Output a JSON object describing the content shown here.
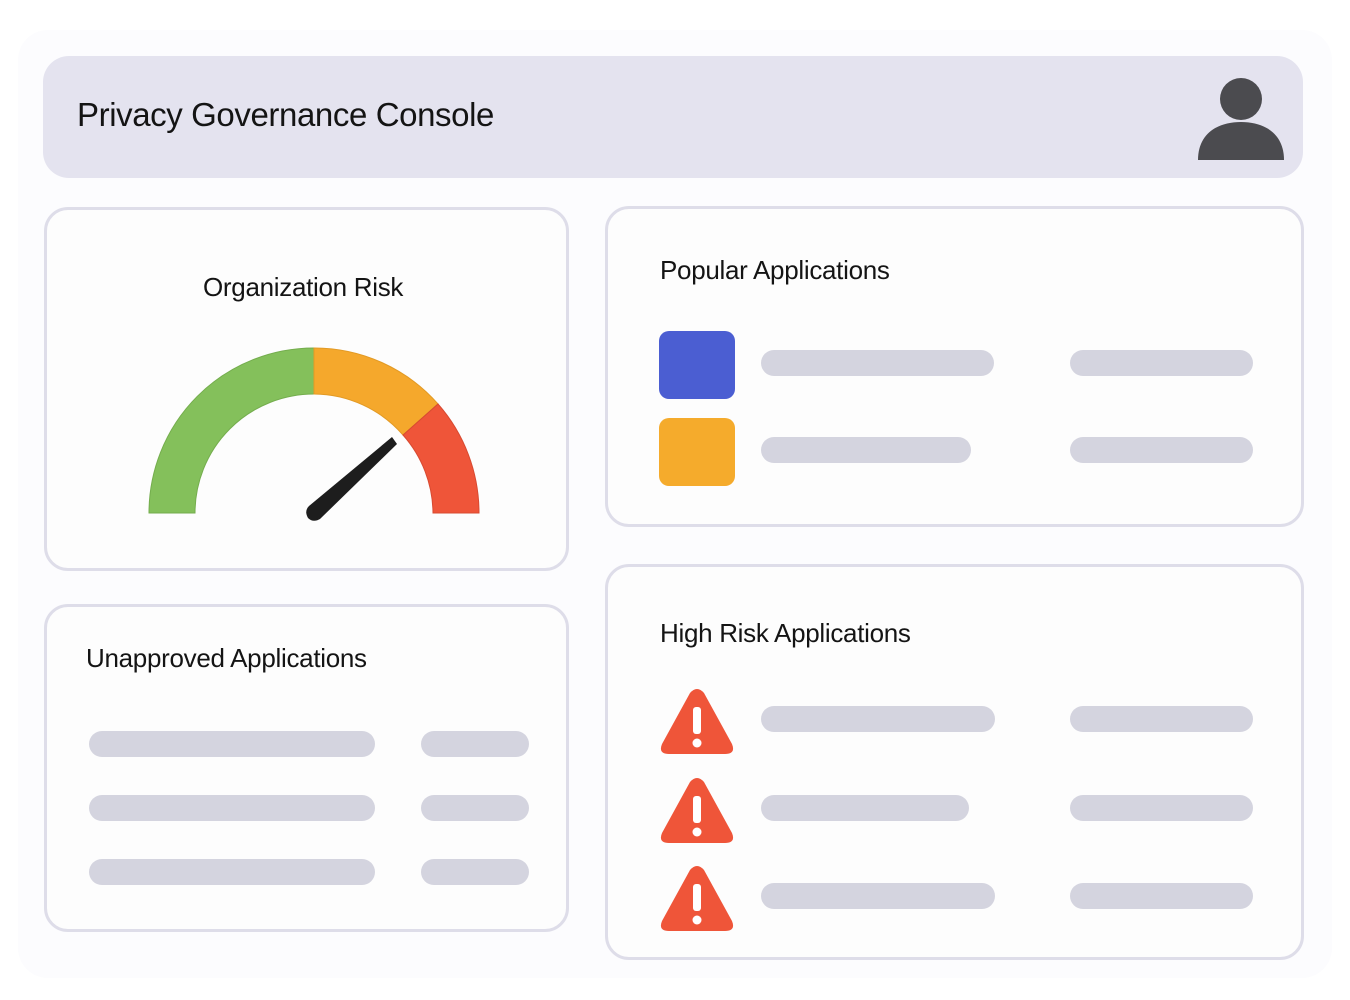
{
  "header": {
    "title": "Privacy Governance Console",
    "user_icon": "user-avatar-icon"
  },
  "org_risk": {
    "title": "Organization Risk",
    "gauge_colors": [
      "#84c05b",
      "#f5a82c",
      "#ef5539"
    ],
    "needle_color": "#1d1d1d"
  },
  "popular_apps": {
    "title": "Popular Applications",
    "items": [
      {
        "color": "#4b5ed2"
      },
      {
        "color": "#f5ab2c"
      }
    ]
  },
  "unapproved_apps": {
    "title": "Unapproved Applications",
    "rows": 3
  },
  "high_risk_apps": {
    "title": "High Risk Applications",
    "icon": "warning-icon",
    "icon_color": "#ef5539",
    "rows": 3
  },
  "placeholder_color": "#d4d4df"
}
